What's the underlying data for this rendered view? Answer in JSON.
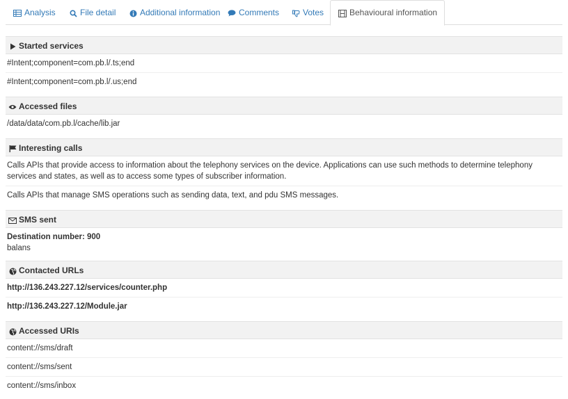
{
  "tabs": [
    {
      "label": "Analysis",
      "icon": "table-icon"
    },
    {
      "label": "File detail",
      "icon": "search-icon"
    },
    {
      "label": "Additional information",
      "icon": "info-icon"
    },
    {
      "label": "Comments",
      "icon": "comment-icon"
    },
    {
      "label": "Votes",
      "icon": "thumbs-down-icon"
    },
    {
      "label": "Behavioural information",
      "icon": "film-icon",
      "active": true
    }
  ],
  "sections": {
    "started_services": {
      "title": "Started services",
      "icon": "play-icon",
      "items": [
        "#Intent;component=com.pb.l/.ts;end",
        "#Intent;component=com.pb.l/.us;end"
      ]
    },
    "accessed_files": {
      "title": "Accessed files",
      "icon": "eye-icon",
      "items": [
        "/data/data/com.pb.l/cache/lib.jar"
      ]
    },
    "interesting_calls": {
      "title": "Interesting calls",
      "icon": "flag-icon",
      "items": [
        "Calls APIs that provide access to information about the telephony services on the device. Applications can use such methods to determine telephony services and states, as well as to access some types of subscriber information.",
        "Calls APIs that manage SMS operations such as sending data, text, and pdu SMS messages."
      ]
    },
    "sms_sent": {
      "title": "SMS sent",
      "icon": "envelope-icon",
      "destination": "Destination number: 900",
      "message": "balans"
    },
    "contacted_urls": {
      "title": "Contacted URLs",
      "icon": "globe-icon",
      "items": [
        "http://136.243.227.12/services/counter.php",
        "http://136.243.227.12/Module.jar"
      ]
    },
    "accessed_uris": {
      "title": "Accessed URIs",
      "icon": "globe-icon",
      "items": [
        "content://sms/draft",
        "content://sms/sent",
        "content://sms/inbox"
      ]
    }
  },
  "colors": {
    "link": "#337ab7",
    "section_bg": "#f2f2f2",
    "border": "#dddddd"
  }
}
